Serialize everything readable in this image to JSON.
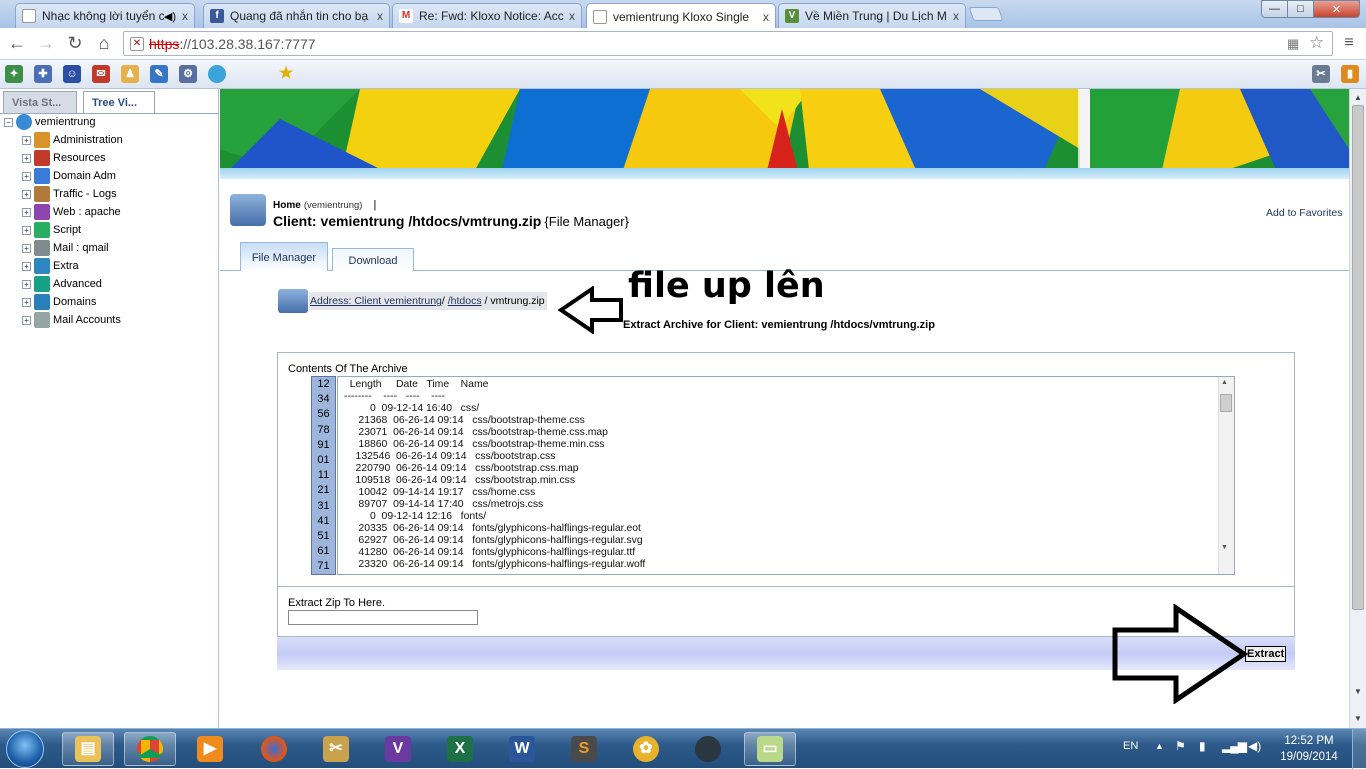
{
  "browser": {
    "tabs": [
      {
        "title": "Nhạc không lời tuyển c",
        "favicon": "page-icon",
        "close": "x"
      },
      {
        "title": "Quang đã nhắn tin cho bạ",
        "favicon": "facebook-icon",
        "close": "x"
      },
      {
        "title": "Re: Fwd: Kloxo Notice: Acc",
        "favicon": "gmail-icon",
        "close": "x"
      },
      {
        "title": "vemientrung Kloxo Single",
        "favicon": "page-icon",
        "close": "x"
      },
      {
        "title": "Về Miền Trung | Du Lịch M",
        "favicon": "site-icon",
        "close": "x"
      }
    ],
    "window_controls": {
      "minimize": "—",
      "maximize": "□",
      "close": "✕"
    },
    "address": {
      "scheme": "https",
      "rest": "://103.28.38.167:7777"
    }
  },
  "left_panel": {
    "tabs": [
      "Vista St...",
      "Tree Vi..."
    ],
    "tree": {
      "root": "vemientrung",
      "items": [
        {
          "label": "Administration",
          "icon": "admin-icon",
          "color": "#d9932b"
        },
        {
          "label": "Resources",
          "icon": "resources-icon",
          "color": "#c0392b"
        },
        {
          "label": "Domain Adm",
          "icon": "domain-adm-icon",
          "color": "#3a7bd5"
        },
        {
          "label": "Traffic - Logs",
          "icon": "traffic-logs-icon",
          "color": "#b07a3a"
        },
        {
          "label": "Web : apache",
          "icon": "web-apache-icon",
          "color": "#8e44ad"
        },
        {
          "label": "Script",
          "icon": "script-icon",
          "color": "#27ae60"
        },
        {
          "label": "Mail : qmail",
          "icon": "mail-icon",
          "color": "#7f8c8d"
        },
        {
          "label": "Extra",
          "icon": "extra-icon",
          "color": "#2e86c1"
        },
        {
          "label": "Advanced",
          "icon": "advanced-icon",
          "color": "#16a085"
        },
        {
          "label": "Domains",
          "icon": "domains-icon",
          "color": "#2980b9"
        },
        {
          "label": "Mail Accounts",
          "icon": "mail-accounts-icon",
          "color": "#95a5a6"
        }
      ]
    }
  },
  "page": {
    "breadcrumb_home": "Home",
    "breadcrumb_user": "(vemientrung)",
    "breadcrumb_sep": "|",
    "title": "Client: vemientrung /htdocs/vmtrung.zip",
    "title_suffix": "{File Manager}",
    "add_favorites": "Add to Favorites",
    "subtabs": [
      "File Manager",
      "Download"
    ],
    "address_label": "Address: Client vemientrung",
    "address_sep1": "/",
    "address_htdocs": "/htdocs",
    "address_file": "/ vmtrung.zip",
    "annotation": "file up lên",
    "extract_title": "Extract Archive for Client: vemientrung /htdocs/vmtrung.zip",
    "contents_label": "Contents Of The Archive",
    "line_numbers": [
      "12",
      "34",
      "56",
      "78",
      "91",
      "01",
      "11",
      "21",
      "31",
      "41",
      "51",
      "61",
      "71"
    ],
    "archive_text": "  Length     Date   Time    Name\n--------    ----   ----    ----\n         0  09-12-14 16:40   css/\n     21368  06-26-14 09:14   css/bootstrap-theme.css\n     23071  06-26-14 09:14   css/bootstrap-theme.css.map\n     18860  06-26-14 09:14   css/bootstrap-theme.min.css\n    132546  06-26-14 09:14   css/bootstrap.css\n    220790  06-26-14 09:14   css/bootstrap.css.map\n    109518  06-26-14 09:14   css/bootstrap.min.css\n     10042  09-14-14 19:17   css/home.css\n     89707  09-14-14 17:40   css/metrojs.css\n         0  09-12-14 12:16   fonts/\n     20335  06-26-14 09:14   fonts/glyphicons-halflings-regular.eot\n     62927  06-26-14 09:14   fonts/glyphicons-halflings-regular.svg\n     41280  06-26-14 09:14   fonts/glyphicons-halflings-regular.ttf\n     23320  06-26-14 09:14   fonts/glyphicons-halflings-regular.woff",
    "extract_to_label": "Extract Zip To Here.",
    "extract_to_value": "",
    "extract_button": "Extract"
  },
  "taskbar": {
    "apps": [
      "start-orb",
      "explorer-icon",
      "chrome-icon",
      "media-player-icon",
      "firefox-icon",
      "tools-icon",
      "visual-studio-icon",
      "excel-icon",
      "word-icon",
      "sublime-icon",
      "unikey-icon",
      "app-icon",
      "notes-icon"
    ],
    "lang": "EN",
    "time": "12:52 PM",
    "date": "19/09/2014"
  }
}
